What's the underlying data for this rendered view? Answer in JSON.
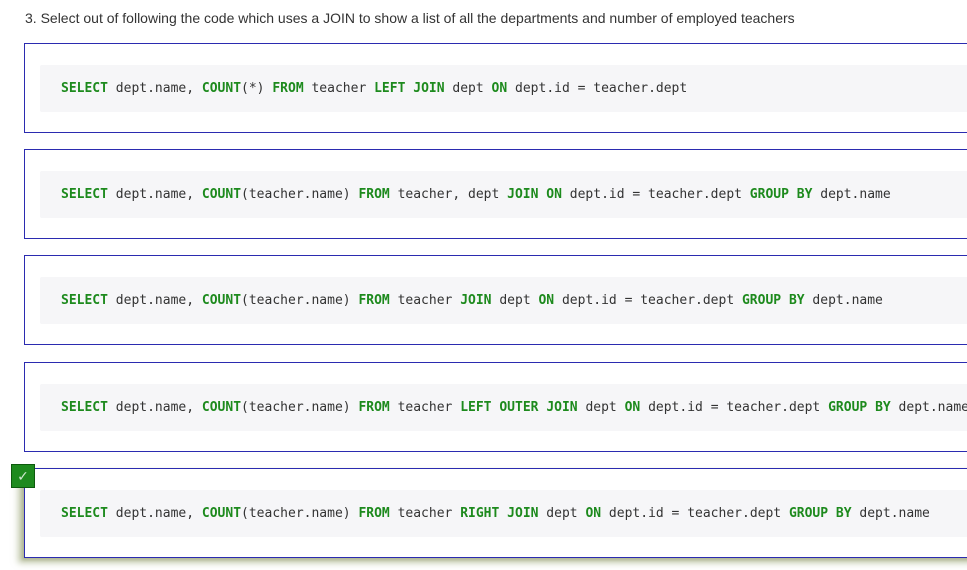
{
  "question": "3. Select out of following the code which uses a JOIN to show a list of all the departments and number of employed teachers",
  "correct_mark": "✓",
  "options": [
    {
      "tokens": [
        {
          "t": "SELECT",
          "k": true
        },
        {
          "t": " dept.name, "
        },
        {
          "t": "COUNT",
          "k": true
        },
        {
          "t": "(*) "
        },
        {
          "t": "FROM",
          "k": true
        },
        {
          "t": " teacher "
        },
        {
          "t": "LEFT",
          "k": true
        },
        {
          "t": " "
        },
        {
          "t": "JOIN",
          "k": true
        },
        {
          "t": " dept "
        },
        {
          "t": "ON",
          "k": true
        },
        {
          "t": " dept.id = teacher.dept"
        }
      ],
      "selected": false
    },
    {
      "tokens": [
        {
          "t": "SELECT",
          "k": true
        },
        {
          "t": " dept.name, "
        },
        {
          "t": "COUNT",
          "k": true
        },
        {
          "t": "(teacher.name) "
        },
        {
          "t": "FROM",
          "k": true
        },
        {
          "t": " teacher, dept "
        },
        {
          "t": "JOIN",
          "k": true
        },
        {
          "t": " "
        },
        {
          "t": "ON",
          "k": true
        },
        {
          "t": " dept.id = teacher.dept "
        },
        {
          "t": "GROUP",
          "k": true
        },
        {
          "t": " "
        },
        {
          "t": "BY",
          "k": true
        },
        {
          "t": " dept.name"
        }
      ],
      "selected": false
    },
    {
      "tokens": [
        {
          "t": "SELECT",
          "k": true
        },
        {
          "t": " dept.name, "
        },
        {
          "t": "COUNT",
          "k": true
        },
        {
          "t": "(teacher.name) "
        },
        {
          "t": "FROM",
          "k": true
        },
        {
          "t": " teacher "
        },
        {
          "t": "JOIN",
          "k": true
        },
        {
          "t": " dept "
        },
        {
          "t": "ON",
          "k": true
        },
        {
          "t": " dept.id = teacher.dept "
        },
        {
          "t": "GROUP",
          "k": true
        },
        {
          "t": " "
        },
        {
          "t": "BY",
          "k": true
        },
        {
          "t": " dept.name"
        }
      ],
      "selected": false
    },
    {
      "tokens": [
        {
          "t": "SELECT",
          "k": true
        },
        {
          "t": " dept.name, "
        },
        {
          "t": "COUNT",
          "k": true
        },
        {
          "t": "(teacher.name) "
        },
        {
          "t": "FROM",
          "k": true
        },
        {
          "t": " teacher "
        },
        {
          "t": "LEFT",
          "k": true
        },
        {
          "t": " "
        },
        {
          "t": "OUTER",
          "k": true
        },
        {
          "t": " "
        },
        {
          "t": "JOIN",
          "k": true
        },
        {
          "t": " dept "
        },
        {
          "t": "ON",
          "k": true
        },
        {
          "t": " dept.id = teacher.dept "
        },
        {
          "t": "GROUP",
          "k": true
        },
        {
          "t": " "
        },
        {
          "t": "BY",
          "k": true
        },
        {
          "t": " dept.name"
        }
      ],
      "selected": false
    },
    {
      "tokens": [
        {
          "t": "SELECT",
          "k": true
        },
        {
          "t": " dept.name, "
        },
        {
          "t": "COUNT",
          "k": true
        },
        {
          "t": "(teacher.name) "
        },
        {
          "t": "FROM",
          "k": true
        },
        {
          "t": " teacher "
        },
        {
          "t": "RIGHT",
          "k": true
        },
        {
          "t": " "
        },
        {
          "t": "JOIN",
          "k": true
        },
        {
          "t": " dept "
        },
        {
          "t": "ON",
          "k": true
        },
        {
          "t": " dept.id = teacher.dept "
        },
        {
          "t": "GROUP",
          "k": true
        },
        {
          "t": " "
        },
        {
          "t": "BY",
          "k": true
        },
        {
          "t": " dept.name"
        }
      ],
      "selected": true
    }
  ],
  "colors": {
    "keyword": "#1d8a1d",
    "option_border": "#2b2bb0",
    "code_background": "#f6f6f8",
    "check_background": "#1e8a1e"
  }
}
